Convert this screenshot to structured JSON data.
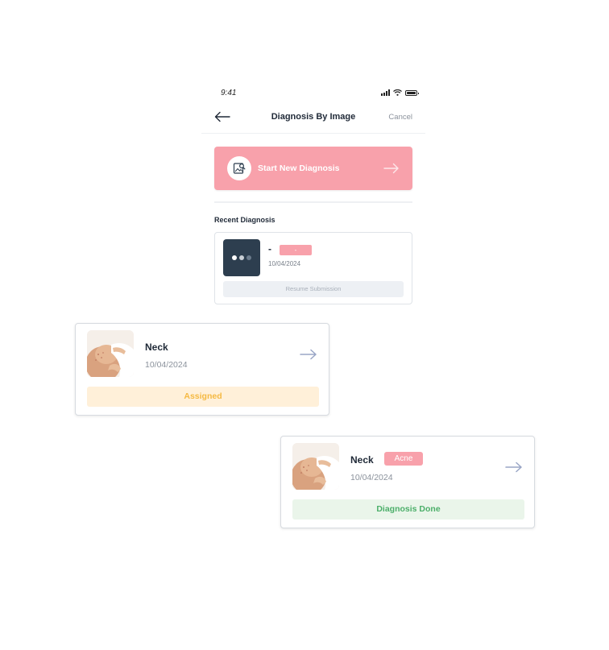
{
  "status_bar": {
    "time": "9:41"
  },
  "header": {
    "title": "Diagnosis By Image",
    "cancel_label": "Cancel"
  },
  "start_button": {
    "label": "Start New Diagnosis"
  },
  "recent": {
    "section_title": "Recent Diagnosis",
    "item": {
      "name": "-",
      "badge": "-",
      "date": "10/04/2024",
      "action_label": "Resume Submission"
    }
  },
  "cards": [
    {
      "location": "Neck",
      "date": "10/04/2024",
      "status": "Assigned",
      "status_color": "#f5b942",
      "status_bg": "#fff0d9"
    },
    {
      "location": "Neck",
      "tag": "Acne",
      "date": "10/04/2024",
      "status": "Diagnosis Done",
      "status_color": "#4caf6a",
      "status_bg": "#eaf5ea"
    }
  ],
  "colors": {
    "accent_pink": "#f8a1ab",
    "dark_thumb": "#2d3e4f",
    "arrow": "#9aa6c6"
  },
  "icons": {
    "back": "arrow-left-icon",
    "start": "image-search-icon",
    "forward": "arrow-right-icon",
    "signal": "signal-icon",
    "wifi": "wifi-icon",
    "battery": "battery-icon"
  }
}
